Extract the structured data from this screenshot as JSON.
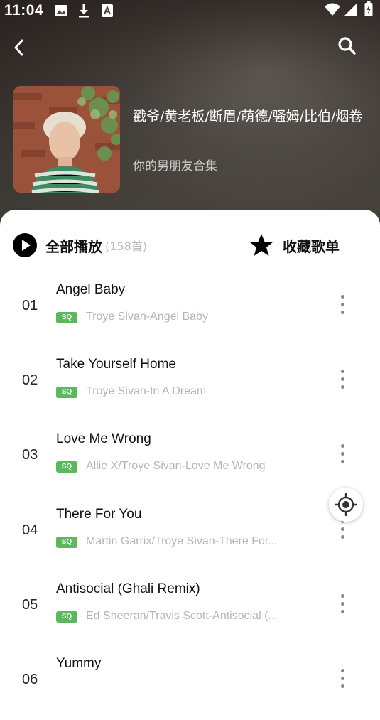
{
  "status_bar": {
    "time": "11:04"
  },
  "header": {
    "playlist_title": "戳爷/黄老板/断眉/萌德/骚姆/比伯/烟卷",
    "playlist_subtitle": "你的男朋友合集"
  },
  "controls": {
    "play_all_label": "全部播放",
    "play_all_count": "(158首)",
    "favorite_label": "收藏歌单"
  },
  "badge_label": "SQ",
  "songs": [
    {
      "num": "01",
      "title": "Angel Baby",
      "subtitle": "Troye Sivan-Angel Baby"
    },
    {
      "num": "02",
      "title": "Take Yourself Home",
      "subtitle": "Troye Sivan-In A Dream"
    },
    {
      "num": "03",
      "title": "Love Me Wrong",
      "subtitle": "Allie X/Troye Sivan-Love Me Wrong"
    },
    {
      "num": "04",
      "title": "There For You",
      "subtitle": "Martin Garrix/Troye Sivan-There For..."
    },
    {
      "num": "05",
      "title": "Antisocial (Ghali Remix)",
      "subtitle": "Ed Sheeran/Travis Scott-Antisocial (..."
    },
    {
      "num": "06",
      "title": "Yummy",
      "subtitle": ""
    }
  ],
  "icons": {
    "back": "chevron-left-icon",
    "search": "search-icon",
    "play": "play-icon",
    "favorite": "star-icon",
    "more": "more-vertical-icon",
    "locate": "locate-icon"
  },
  "colors": {
    "sq_badge": "#5cb85c",
    "accent": "#000000"
  }
}
